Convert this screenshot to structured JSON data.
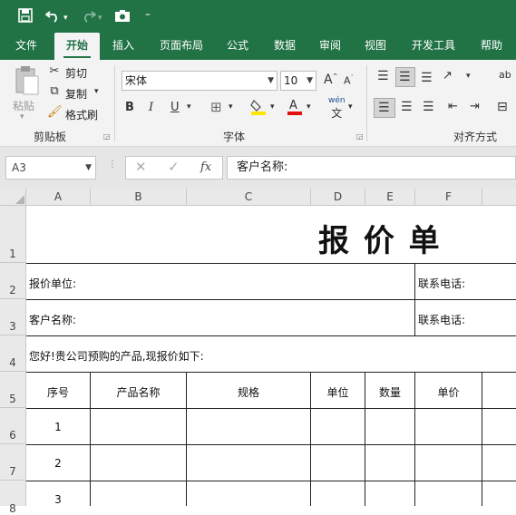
{
  "colors": {
    "accent": "#217346",
    "ribbon_bg": "#f3f3f3"
  },
  "quick_access": {
    "icons": [
      "save-icon",
      "undo-icon",
      "redo-icon",
      "camera-icon",
      "customize-icon"
    ]
  },
  "tabs": [
    {
      "label": "文件",
      "active": false
    },
    {
      "label": "开始",
      "active": true
    },
    {
      "label": "插入",
      "active": false
    },
    {
      "label": "页面布局",
      "active": false
    },
    {
      "label": "公式",
      "active": false
    },
    {
      "label": "数据",
      "active": false
    },
    {
      "label": "审阅",
      "active": false
    },
    {
      "label": "视图",
      "active": false
    },
    {
      "label": "开发工具",
      "active": false
    },
    {
      "label": "帮助",
      "active": false
    }
  ],
  "ribbon": {
    "clipboard": {
      "paste": "粘贴",
      "cut": "剪切",
      "copy": "复制",
      "format_painter": "格式刷",
      "group": "剪贴板"
    },
    "font": {
      "name": "宋体",
      "size": "10",
      "bold": "B",
      "italic": "I",
      "underline": "U",
      "group": "字体",
      "grow": "A",
      "shrink": "A",
      "phonetic": "wén"
    },
    "alignment": {
      "group": "对齐方式",
      "wrap": "ab"
    }
  },
  "formula_bar": {
    "name_box": "A3",
    "formula": "客户名称:",
    "fx": "fx"
  },
  "grid": {
    "columns": [
      "A",
      "B",
      "C",
      "D",
      "E",
      "F"
    ],
    "rows": [
      "1",
      "2",
      "3",
      "4",
      "5",
      "6",
      "7",
      "8"
    ],
    "title": "报 价 单",
    "row2_left": "报价单位:",
    "row2_right": "联系电话:",
    "row3_left": "客户名称:",
    "row3_right": "联系电话:",
    "row4": "您好!贵公司预购的产品,现报价如下:",
    "headers": [
      "序号",
      "产品名称",
      "规格",
      "单位",
      "数量",
      "单价"
    ],
    "serials": [
      "1",
      "2",
      "3"
    ]
  }
}
